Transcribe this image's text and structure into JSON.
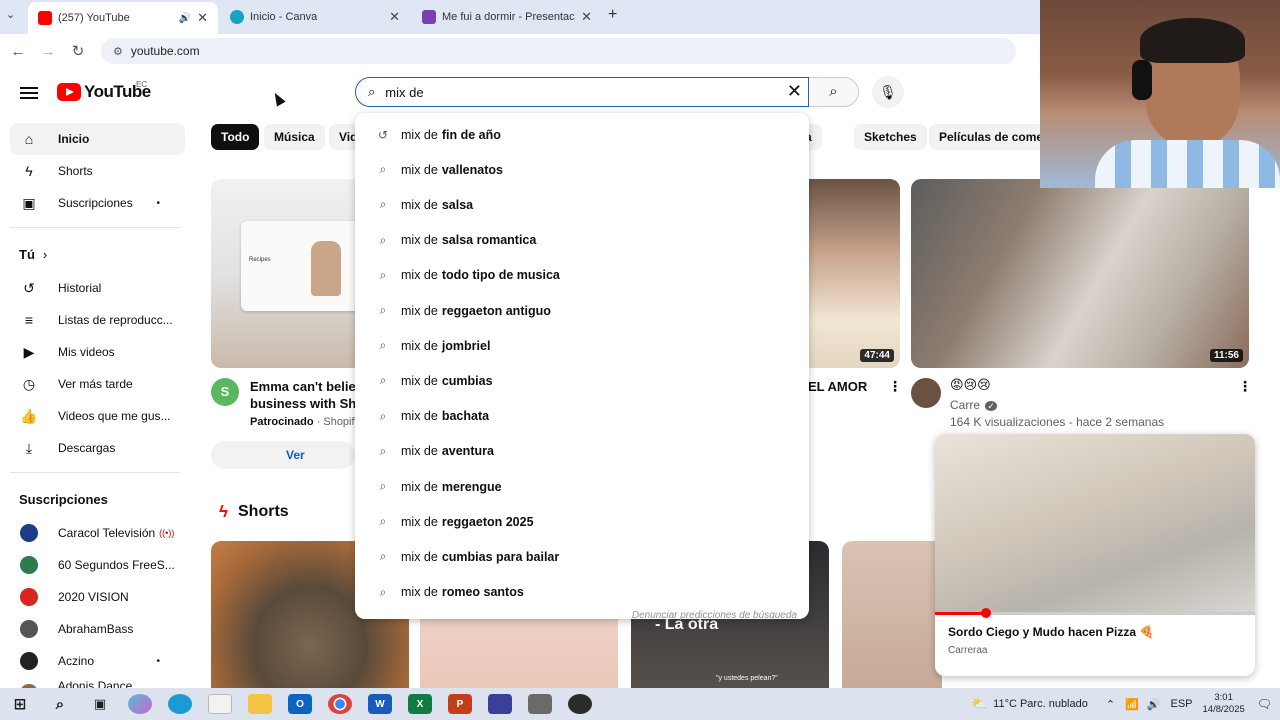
{
  "browser": {
    "tabs": [
      {
        "title": "(257) YouTube",
        "active": true
      },
      {
        "title": "Inicio - Canva",
        "active": false
      },
      {
        "title": "Me fui a dormir - Presentación",
        "active": false
      }
    ],
    "url": "youtube.com"
  },
  "header": {
    "logo_text": "YouTube",
    "region": "EC",
    "search_value": "mix de "
  },
  "sidebar": {
    "main": [
      {
        "label": "Inicio",
        "icon": "home-icon"
      },
      {
        "label": "Shorts",
        "icon": "shorts-icon"
      },
      {
        "label": "Suscripciones",
        "icon": "subscriptions-icon"
      }
    ],
    "you_header": "Tú",
    "you": [
      {
        "label": "Historial",
        "icon": "history-icon"
      },
      {
        "label": "Listas de reproducc...",
        "icon": "playlist-icon"
      },
      {
        "label": "Mis videos",
        "icon": "my-videos-icon"
      },
      {
        "label": "Ver más tarde",
        "icon": "watch-later-icon"
      },
      {
        "label": "Videos que me gus...",
        "icon": "like-icon"
      },
      {
        "label": "Descargas",
        "icon": "download-icon"
      }
    ],
    "subs_header": "Suscripciones",
    "subs": [
      {
        "label": "Caracol Televisión",
        "color": "#1a3c8a"
      },
      {
        "label": "60 Segundos FreeS...",
        "color": "#2d7a4a"
      },
      {
        "label": "2020 VISION",
        "color": "#d8261c"
      },
      {
        "label": "AbrahamBass",
        "color": "#555555"
      },
      {
        "label": "Aczino",
        "color": "#222222"
      },
      {
        "label": "Adonis Dance Ac...",
        "color": "#8a6a4a"
      }
    ]
  },
  "chips": [
    "Todo",
    "Música",
    "Vid",
    "icana",
    "Sketches",
    "Películas de comedi"
  ],
  "suggestions": {
    "prefix": "mix de",
    "items": [
      "fin de año",
      "vallenatos",
      "salsa",
      "salsa romantica",
      "todo tipo de musica",
      "reggaeton antiguo",
      "jombriel",
      "cumbias",
      "bachata",
      "aventura",
      "merengue",
      "reggaeton 2025",
      "cumbias para bailar",
      "romeo santos"
    ],
    "report": "Denunciar predicciones de búsqueda"
  },
  "videos": {
    "ad": {
      "title1": "Emma can't believe",
      "title2": "business with Sho",
      "sponsored": "Patrocinado",
      "sponsor": "· Shopify",
      "button": "Ver",
      "thumb_label": "Recipes"
    },
    "v2": {
      "duration": "47:44",
      "title": "EL AMOR"
    },
    "v3": {
      "duration": "11:56",
      "channel": "Carre",
      "views": "164 K visualizaciones - hace 2 semanas"
    }
  },
  "shorts_header": "Shorts",
  "short_overlay": "- La otra",
  "short_caption": "\"y ustedes pelean?\"",
  "miniplayer": {
    "title": "Sordo Ciego y Mudo hacen Pizza 🍕",
    "channel": "Carreraa",
    "progress": 0.16
  },
  "taskbar": {
    "weather": "11°C  Parc. nublado",
    "lang": "ESP",
    "time": "3:01",
    "date": "14/8/2025"
  }
}
